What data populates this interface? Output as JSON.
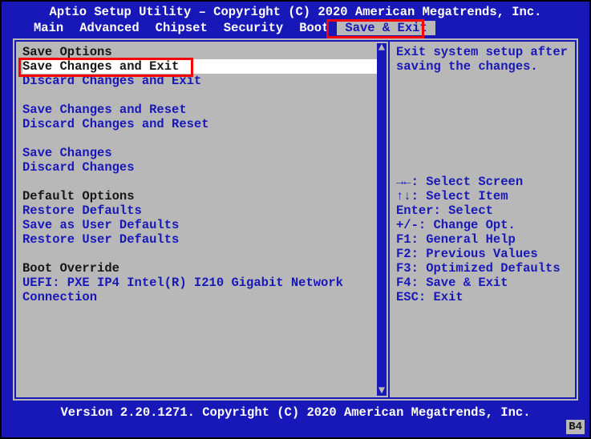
{
  "title": "Aptio Setup Utility – Copyright (C) 2020 American Megatrends, Inc.",
  "menubar": {
    "tabs": [
      "Main",
      "Advanced",
      "Chipset",
      "Security",
      "Boot",
      "Save & Exit"
    ],
    "active_index": 5
  },
  "left_pane": {
    "rows": [
      {
        "type": "hdr",
        "text": "Save Options"
      },
      {
        "type": "item",
        "text": "Save Changes and Exit",
        "selected": true
      },
      {
        "type": "item",
        "text": "Discard Changes and Exit"
      },
      {
        "type": "blank"
      },
      {
        "type": "item",
        "text": "Save Changes and Reset"
      },
      {
        "type": "item",
        "text": "Discard Changes and Reset"
      },
      {
        "type": "blank"
      },
      {
        "type": "item",
        "text": "Save Changes"
      },
      {
        "type": "item",
        "text": "Discard Changes"
      },
      {
        "type": "blank"
      },
      {
        "type": "hdr",
        "text": "Default Options"
      },
      {
        "type": "item",
        "text": "Restore Defaults"
      },
      {
        "type": "item",
        "text": "Save as User Defaults"
      },
      {
        "type": "item",
        "text": "Restore User Defaults"
      },
      {
        "type": "blank"
      },
      {
        "type": "hdr",
        "text": "Boot Override"
      },
      {
        "type": "item",
        "text": "UEFI: PXE IP4 Intel(R) I210 Gigabit  Network"
      },
      {
        "type": "item",
        "text": "Connection"
      }
    ]
  },
  "right_pane": {
    "help": "Exit system setup after saving the changes.",
    "keys": [
      "→←: Select Screen",
      "↑↓: Select Item",
      "Enter: Select",
      "+/-: Change Opt.",
      "F1: General Help",
      "F2: Previous Values",
      "F3: Optimized Defaults",
      "F4: Save & Exit",
      "ESC: Exit"
    ]
  },
  "footer": "Version 2.20.1271. Copyright (C) 2020 American Megatrends, Inc.",
  "badge": "B4"
}
